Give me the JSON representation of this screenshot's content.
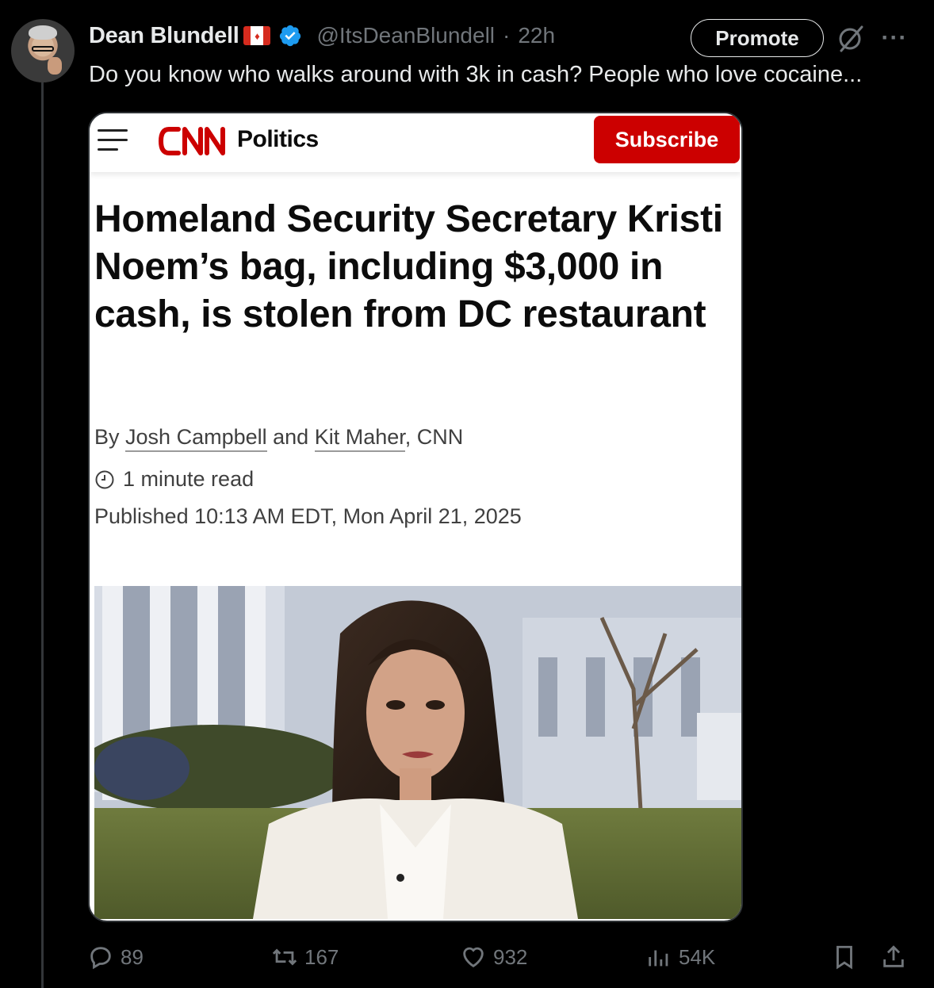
{
  "post": {
    "author_name": "Dean Blundell",
    "handle": "@ItsDeanBlundell",
    "separator": "·",
    "time": "22h",
    "text": "Do you know who walks around with 3k in cash? People who love cocaine...",
    "promote_label": "Promote",
    "more_label": "···"
  },
  "article": {
    "section": "Politics",
    "subscribe_label": "Subscribe",
    "headline": "Homeland Security Secretary Kristi Noem’s bag, including $3,000 in cash, is stolen from DC restaurant",
    "byline_prefix": "By",
    "author1": "Josh Campbell",
    "byline_and": "and",
    "author2": "Kit Maher",
    "byline_suffix": ", CNN",
    "read_time": "1 minute read",
    "published": "Published 10:13 AM EDT, Mon April 21, 2025"
  },
  "actions": {
    "replies": "89",
    "reposts": "167",
    "likes": "932",
    "views": "54K"
  },
  "colors": {
    "background": "#000000",
    "text": "#e7e9ea",
    "muted": "#71767b",
    "verified": "#1d9bf0",
    "cnn_red": "#cc0000"
  }
}
